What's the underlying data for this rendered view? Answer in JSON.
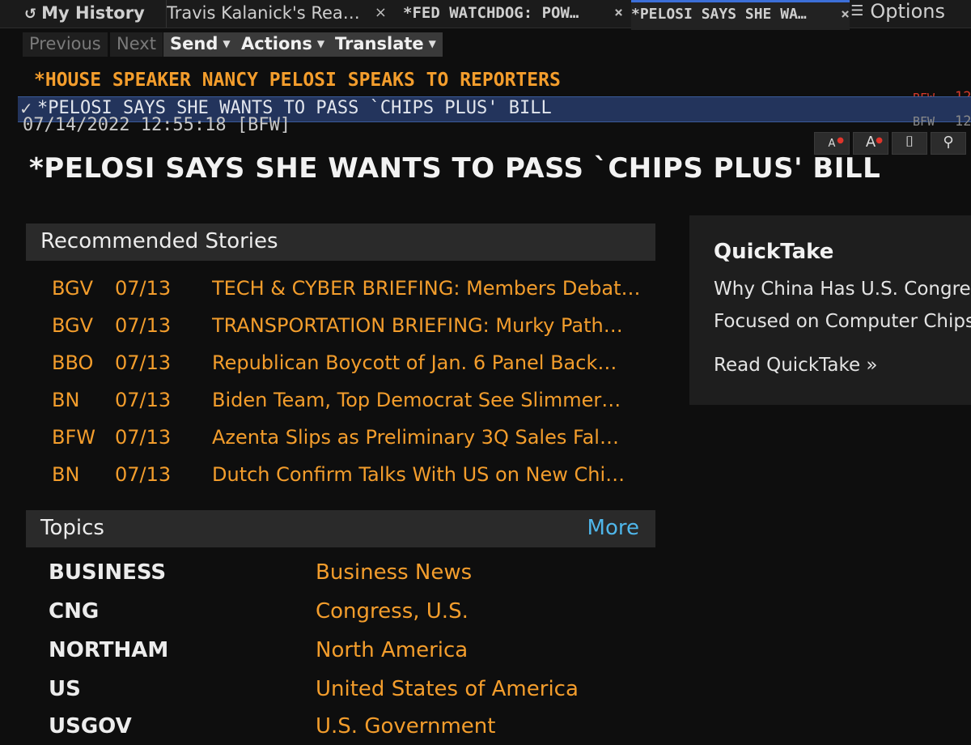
{
  "tabs": {
    "history": "My History",
    "items": [
      {
        "label": "Travis Kalanick's Rea…",
        "close": "×"
      },
      {
        "label": "*FED WATCHDOG: POW…",
        "close": "×"
      },
      {
        "label": "*PELOSI SAYS SHE WA…",
        "close": "×"
      }
    ],
    "options": "Options"
  },
  "toolbar": {
    "previous": "Previous",
    "next": "Next",
    "send": "Send",
    "actions": "Actions",
    "translate": "Translate"
  },
  "headlines": {
    "orange": "*HOUSE SPEAKER NANCY PELOSI SPEAKS TO REPORTERS",
    "selected": "*PELOSI SAYS SHE WANTS TO PASS `CHIPS PLUS' BILL",
    "selected_source": "BFW",
    "selected_num": "12",
    "timestamp": "07/14/2022 12:55:18 [BFW]",
    "timestamp_source": "BFW",
    "timestamp_num": "12"
  },
  "article": {
    "title": "*PELOSI SAYS SHE WANTS TO PASS `CHIPS PLUS' BILL"
  },
  "recommended": {
    "title": "Recommended Stories",
    "stories": [
      {
        "src": "BGV",
        "date": "07/13",
        "title": "TECH & CYBER BRIEFING: Members Debat…"
      },
      {
        "src": "BGV",
        "date": "07/13",
        "title": "TRANSPORTATION BRIEFING: Murky Path…"
      },
      {
        "src": "BBO",
        "date": "07/13",
        "title": "Republican Boycott of Jan. 6 Panel Back…"
      },
      {
        "src": "BN",
        "date": "07/13",
        "title": "Biden Team, Top Democrat See Slimmer…"
      },
      {
        "src": "BFW",
        "date": "07/13",
        "title": "Azenta Slips as Preliminary 3Q Sales Fal…"
      },
      {
        "src": "BN",
        "date": "07/13",
        "title": "Dutch Confirm Talks With US on New Chi…"
      }
    ]
  },
  "topics": {
    "title": "Topics",
    "more": "More",
    "items": [
      {
        "code": "BUSINESS",
        "name": "Business News"
      },
      {
        "code": "CNG",
        "name": "Congress, U.S."
      },
      {
        "code": "NORTHAM",
        "name": "North America"
      },
      {
        "code": "US",
        "name": "United States of America"
      },
      {
        "code": "USGOV",
        "name": "U.S. Government"
      }
    ]
  },
  "quicktake": {
    "title": "QuickTake",
    "line1": "Why China Has U.S. Congress",
    "line2": "Focused on Computer Chips",
    "read": "Read QuickTake »"
  },
  "colors": {
    "orange": "#f39d2c",
    "selected_bg": "#23345c",
    "link_blue": "#4fb6ea",
    "active_tab": "#3c6fd8"
  }
}
